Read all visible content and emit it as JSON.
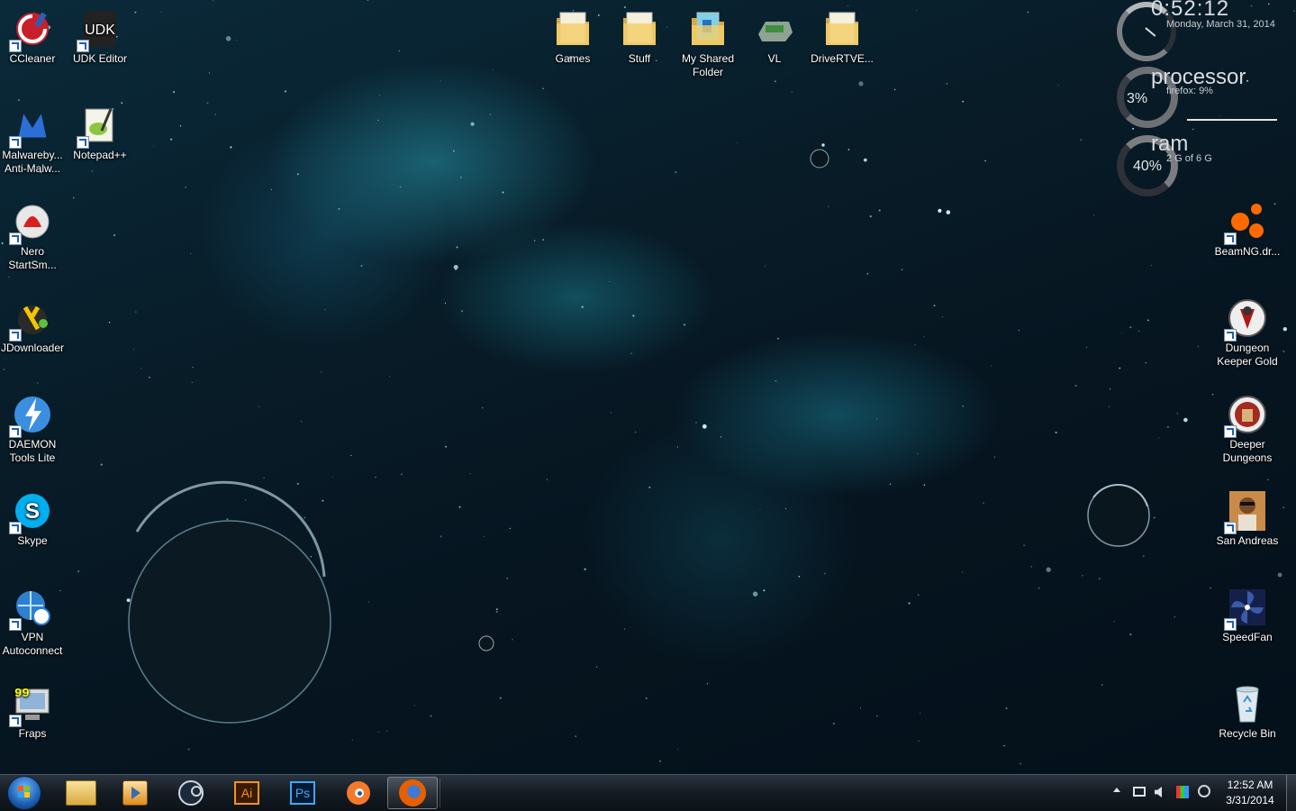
{
  "desktop": {
    "left_icons": [
      {
        "label": "CCleaner",
        "icon": "ccleaner-icon"
      },
      {
        "label": "UDK Editor",
        "icon": "udk-icon"
      },
      {
        "label": "Malwareby... Anti-Malw...",
        "icon": "malwarebytes-icon"
      },
      {
        "label": "Notepad++",
        "icon": "notepadpp-icon"
      },
      {
        "label": "Nero StartSm...",
        "icon": "nero-icon"
      },
      {
        "label": "JDownloader",
        "icon": "jdownloader-icon"
      },
      {
        "label": "DAEMON Tools Lite",
        "icon": "daemon-tools-icon"
      },
      {
        "label": "Skype",
        "icon": "skype-icon"
      },
      {
        "label": "VPN Autoconnect",
        "icon": "vpn-icon"
      },
      {
        "label": "Fraps",
        "icon": "fraps-icon"
      }
    ],
    "top_icons": [
      {
        "label": "Games",
        "icon": "folder-icon"
      },
      {
        "label": "Stuff",
        "icon": "folder-icon"
      },
      {
        "label": "My Shared Folder",
        "icon": "shared-folder-icon"
      },
      {
        "label": "VL",
        "icon": "drive-icon"
      },
      {
        "label": "DriveRTVE...",
        "icon": "folder-icon"
      }
    ],
    "right_icons": [
      {
        "label": "BeamNG.dr...",
        "icon": "beamng-icon"
      },
      {
        "label": "Dungeon Keeper Gold",
        "icon": "dungeon-keeper-icon"
      },
      {
        "label": "Deeper Dungeons",
        "icon": "deeper-dungeons-icon"
      },
      {
        "label": "San Andreas",
        "icon": "san-andreas-icon"
      },
      {
        "label": "SpeedFan",
        "icon": "speedfan-icon"
      },
      {
        "label": "Recycle Bin",
        "icon": "recycle-bin-icon"
      }
    ]
  },
  "gadgets": {
    "clock": {
      "time": "0:52:12",
      "date": "Monday, March 31, 2014"
    },
    "processor": {
      "title": "processor",
      "percent_label": "3%",
      "detail": "firefox: 9%",
      "level": 0.03
    },
    "ram": {
      "title": "ram",
      "percent_label": "40%",
      "detail": "2 G of 6 G",
      "level": 0.4
    }
  },
  "taskbar": {
    "pinned": [
      "start-orb-icon",
      "explorer-icon",
      "media-player-icon",
      "steam-icon",
      "illustrator-icon",
      "photoshop-icon",
      "blender-icon",
      "firefox-icon"
    ],
    "illustrator_text": "Ai",
    "photoshop_text": "Ps",
    "tray": {
      "time": "12:52 AM",
      "date": "3/31/2014"
    }
  }
}
